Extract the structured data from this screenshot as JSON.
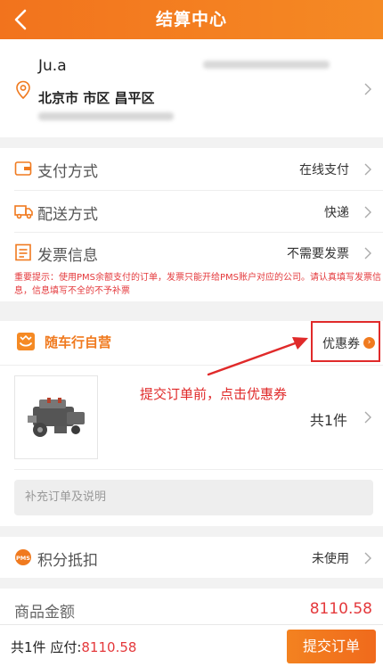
{
  "header": {
    "title": "结算中心"
  },
  "address": {
    "name": "Ju.a",
    "region": "北京市 市区 昌平区"
  },
  "options": {
    "payment": {
      "label": "支付方式",
      "value": "在线支付"
    },
    "delivery": {
      "label": "配送方式",
      "value": "快递"
    },
    "invoice": {
      "label": "发票信息",
      "value": "不需要发票"
    },
    "notice": "重要提示：使用PMS余额支付的订单，发票只能开给PMS账户对应的公司。请认真填写发票信息，信息填写不全的不予补票"
  },
  "shop": {
    "name": "随车行自营",
    "coupon_label": "优惠券",
    "product_count": "共1件",
    "remark_placeholder": "补充订单及说明"
  },
  "annotation": "提交订单前，点击优惠券",
  "points": {
    "label": "积分抵扣",
    "value": "未使用"
  },
  "amount": {
    "label": "商品金额",
    "value": "8110.58"
  },
  "footer": {
    "count": "共1件",
    "payable_label": "应付:",
    "payable_value": "8110.58",
    "submit_label": "提交订单"
  },
  "colors": {
    "brand": "#f2731d",
    "price": "#e4393c",
    "annotation": "#e02a2a"
  }
}
